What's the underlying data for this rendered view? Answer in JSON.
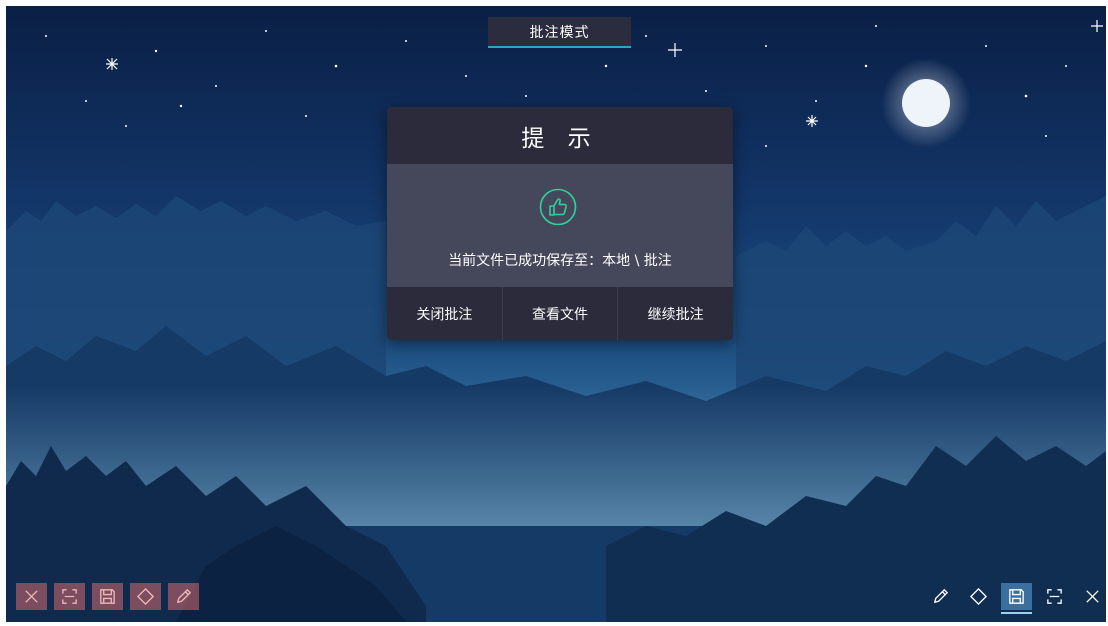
{
  "mode_tab": {
    "label": "批注模式"
  },
  "dialog": {
    "title": "提 示",
    "icon": "thumbs-up-icon",
    "message": "当前文件已成功保存至：本地 \\ 批注",
    "actions": [
      {
        "label": "关闭批注"
      },
      {
        "label": "查看文件"
      },
      {
        "label": "继续批注"
      }
    ]
  },
  "toolbar_left": {
    "state": "disabled",
    "tools": [
      "close-icon",
      "fullscreen-icon",
      "save-icon",
      "eraser-icon",
      "pen-icon"
    ]
  },
  "toolbar_right": {
    "tools": [
      "pen-icon",
      "eraser-icon",
      "save-icon",
      "fullscreen-icon",
      "close-icon"
    ],
    "active_tool": "save-icon"
  },
  "colors": {
    "dialog_dark": "#2b2b3b",
    "dialog_body": "#45475a",
    "accent_green": "#2fd19a",
    "accent_blue": "#2aa5c8"
  }
}
